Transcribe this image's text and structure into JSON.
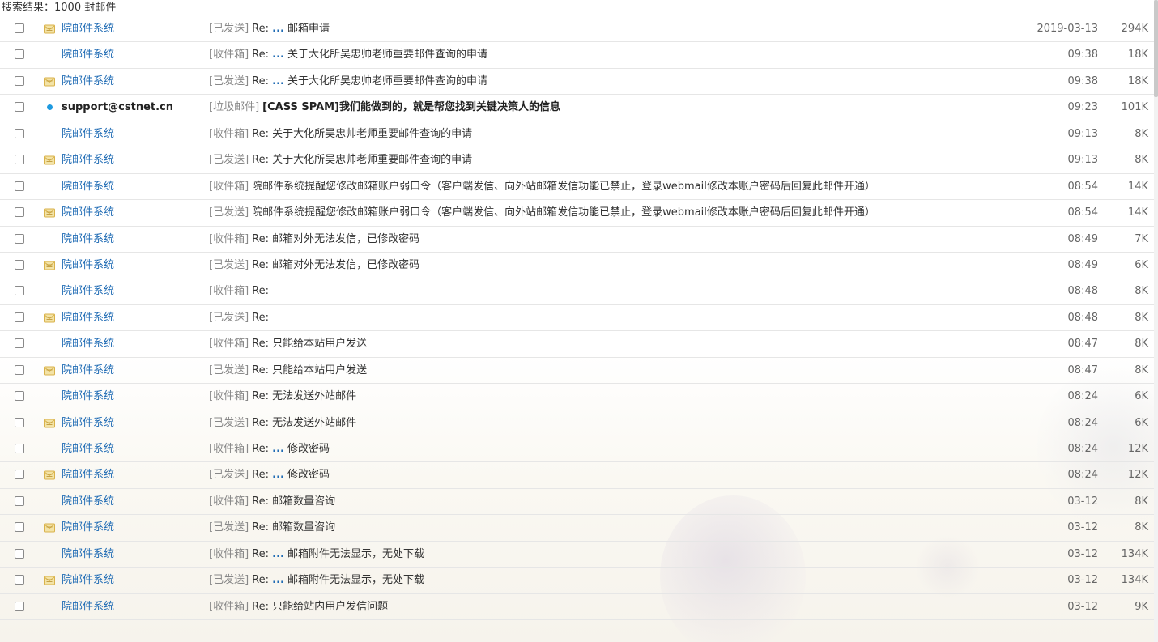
{
  "summary": {
    "label": "搜索结果：",
    "count": "1000",
    "unit": "封邮件"
  },
  "colors": {
    "sender_link": "#1f6bb4",
    "folder_tag": "#888888",
    "unread_dot": "#1e9ae0",
    "envelope_icon": "#d9b24a"
  },
  "mails": [
    {
      "status_icon": "envelope-icon",
      "sender": "院邮件系统",
      "folder": "[已发送]",
      "prefix": "Re:",
      "ellipsis": "...",
      "subject": "邮箱申请",
      "date": "2019-03-13",
      "size": "294K",
      "unread": false
    },
    {
      "status_icon": "",
      "sender": "院邮件系统",
      "folder": "[收件箱]",
      "prefix": "Re:",
      "ellipsis": "...",
      "subject": "关于大化所吴忠帅老师重要邮件查询的申请",
      "date": "09:38",
      "size": "18K",
      "unread": false
    },
    {
      "status_icon": "envelope-icon",
      "sender": "院邮件系统",
      "folder": "[已发送]",
      "prefix": "Re:",
      "ellipsis": "...",
      "subject": "关于大化所吴忠帅老师重要邮件查询的申请",
      "date": "09:38",
      "size": "18K",
      "unread": false
    },
    {
      "status_icon": "unread-dot-icon",
      "sender": "support@cstnet.cn",
      "folder": "[垃圾邮件]",
      "prefix": "",
      "ellipsis": "",
      "subject": "[CASS SPAM]我们能做到的，就是帮您找到关键决策人的信息",
      "date": "09:23",
      "size": "101K",
      "unread": true
    },
    {
      "status_icon": "",
      "sender": "院邮件系统",
      "folder": "[收件箱]",
      "prefix": "Re:",
      "ellipsis": "",
      "subject": "关于大化所吴忠帅老师重要邮件查询的申请",
      "date": "09:13",
      "size": "8K",
      "unread": false
    },
    {
      "status_icon": "envelope-icon",
      "sender": "院邮件系统",
      "folder": "[已发送]",
      "prefix": "Re:",
      "ellipsis": "",
      "subject": "关于大化所吴忠帅老师重要邮件查询的申请",
      "date": "09:13",
      "size": "8K",
      "unread": false
    },
    {
      "status_icon": "",
      "sender": "院邮件系统",
      "folder": "[收件箱]",
      "prefix": "",
      "ellipsis": "",
      "subject": "院邮件系统提醒您修改邮箱账户弱口令（客户端发信、向外站邮箱发信功能已禁止，登录webmail修改本账户密码后回复此邮件开通）",
      "date": "08:54",
      "size": "14K",
      "unread": false
    },
    {
      "status_icon": "envelope-icon",
      "sender": "院邮件系统",
      "folder": "[已发送]",
      "prefix": "",
      "ellipsis": "",
      "subject": "院邮件系统提醒您修改邮箱账户弱口令（客户端发信、向外站邮箱发信功能已禁止，登录webmail修改本账户密码后回复此邮件开通）",
      "date": "08:54",
      "size": "14K",
      "unread": false
    },
    {
      "status_icon": "",
      "sender": "院邮件系统",
      "folder": "[收件箱]",
      "prefix": "Re:",
      "ellipsis": "",
      "subject": "邮箱对外无法发信，已修改密码",
      "date": "08:49",
      "size": "7K",
      "unread": false
    },
    {
      "status_icon": "envelope-icon",
      "sender": "院邮件系统",
      "folder": "[已发送]",
      "prefix": "Re:",
      "ellipsis": "",
      "subject": "邮箱对外无法发信，已修改密码",
      "date": "08:49",
      "size": "6K",
      "unread": false
    },
    {
      "status_icon": "",
      "sender": "院邮件系统",
      "folder": "[收件箱]",
      "prefix": "Re:",
      "ellipsis": "",
      "subject": "",
      "date": "08:48",
      "size": "8K",
      "unread": false
    },
    {
      "status_icon": "envelope-icon",
      "sender": "院邮件系统",
      "folder": "[已发送]",
      "prefix": "Re:",
      "ellipsis": "",
      "subject": "",
      "date": "08:48",
      "size": "8K",
      "unread": false
    },
    {
      "status_icon": "",
      "sender": "院邮件系统",
      "folder": "[收件箱]",
      "prefix": "Re:",
      "ellipsis": "",
      "subject": "只能给本站用户发送",
      "date": "08:47",
      "size": "8K",
      "unread": false
    },
    {
      "status_icon": "envelope-icon",
      "sender": "院邮件系统",
      "folder": "[已发送]",
      "prefix": "Re:",
      "ellipsis": "",
      "subject": "只能给本站用户发送",
      "date": "08:47",
      "size": "8K",
      "unread": false
    },
    {
      "status_icon": "",
      "sender": "院邮件系统",
      "folder": "[收件箱]",
      "prefix": "Re:",
      "ellipsis": "",
      "subject": "无法发送外站邮件",
      "date": "08:24",
      "size": "6K",
      "unread": false
    },
    {
      "status_icon": "envelope-icon",
      "sender": "院邮件系统",
      "folder": "[已发送]",
      "prefix": "Re:",
      "ellipsis": "",
      "subject": "无法发送外站邮件",
      "date": "08:24",
      "size": "6K",
      "unread": false
    },
    {
      "status_icon": "",
      "sender": "院邮件系统",
      "folder": "[收件箱]",
      "prefix": "Re:",
      "ellipsis": "...",
      "subject": "修改密码",
      "date": "08:24",
      "size": "12K",
      "unread": false
    },
    {
      "status_icon": "envelope-icon",
      "sender": "院邮件系统",
      "folder": "[已发送]",
      "prefix": "Re:",
      "ellipsis": "...",
      "subject": "修改密码",
      "date": "08:24",
      "size": "12K",
      "unread": false
    },
    {
      "status_icon": "",
      "sender": "院邮件系统",
      "folder": "[收件箱]",
      "prefix": "Re:",
      "ellipsis": "",
      "subject": "邮箱数量咨询",
      "date": "03-12",
      "size": "8K",
      "unread": false
    },
    {
      "status_icon": "envelope-icon",
      "sender": "院邮件系统",
      "folder": "[已发送]",
      "prefix": "Re:",
      "ellipsis": "",
      "subject": "邮箱数量咨询",
      "date": "03-12",
      "size": "8K",
      "unread": false
    },
    {
      "status_icon": "",
      "sender": "院邮件系统",
      "folder": "[收件箱]",
      "prefix": "Re:",
      "ellipsis": "...",
      "subject": "邮箱附件无法显示，无处下载",
      "date": "03-12",
      "size": "134K",
      "unread": false
    },
    {
      "status_icon": "envelope-icon",
      "sender": "院邮件系统",
      "folder": "[已发送]",
      "prefix": "Re:",
      "ellipsis": "...",
      "subject": "邮箱附件无法显示，无处下载",
      "date": "03-12",
      "size": "134K",
      "unread": false
    },
    {
      "status_icon": "",
      "sender": "院邮件系统",
      "folder": "[收件箱]",
      "prefix": "Re:",
      "ellipsis": "",
      "subject": "只能给站内用户发信问题",
      "date": "03-12",
      "size": "9K",
      "unread": false
    }
  ]
}
